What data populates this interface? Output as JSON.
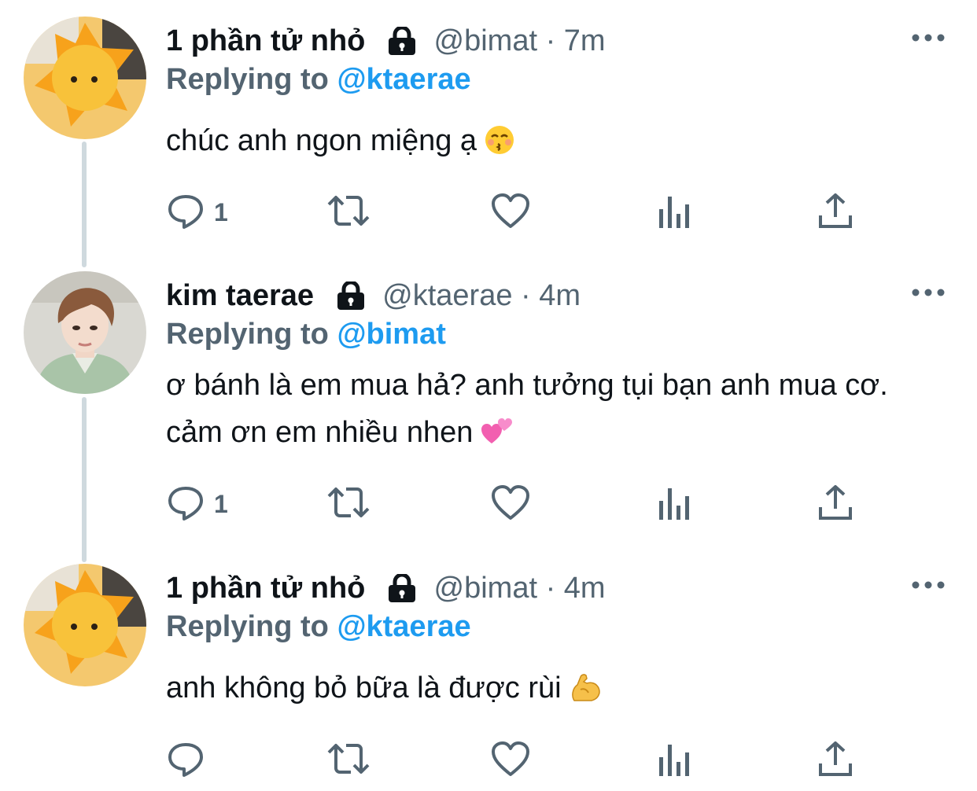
{
  "tweets": [
    {
      "display_name": "1 phần tử nhỏ",
      "handle": "@bimat",
      "separator": "·",
      "time": "7m",
      "replying_prefix": "Replying to",
      "replying_to": "@ktaerae",
      "text": "chúc anh ngon miệng ạ",
      "emoji": "kissing-face-closed-eyes",
      "reply_count": "1",
      "avatar": "yellow-star-plush"
    },
    {
      "display_name": "kim taerae",
      "handle": "@ktaerae",
      "separator": "·",
      "time": "4m",
      "replying_prefix": "Replying to",
      "replying_to": "@bimat",
      "text": "ơ bánh là em mua hả? anh tưởng tụi bạn anh mua cơ. cảm ơn em nhiều nhen",
      "emoji": "two-hearts",
      "reply_count": "1",
      "avatar": "person-photo"
    },
    {
      "display_name": "1 phần tử nhỏ",
      "handle": "@bimat",
      "separator": "·",
      "time": "4m",
      "replying_prefix": "Replying to",
      "replying_to": "@ktaerae",
      "text": "anh không bỏ bữa là được rùi",
      "emoji": "flexed-biceps",
      "reply_count": "",
      "avatar": "yellow-star-plush"
    }
  ],
  "icons": [
    "lock-icon",
    "more-icon",
    "reply-icon",
    "retweet-icon",
    "like-icon",
    "analytics-icon",
    "share-icon"
  ],
  "colors": {
    "text": "#0f1419",
    "secondary": "#536471",
    "mention": "#1d9bf0",
    "thread_line": "#cfd9de"
  }
}
